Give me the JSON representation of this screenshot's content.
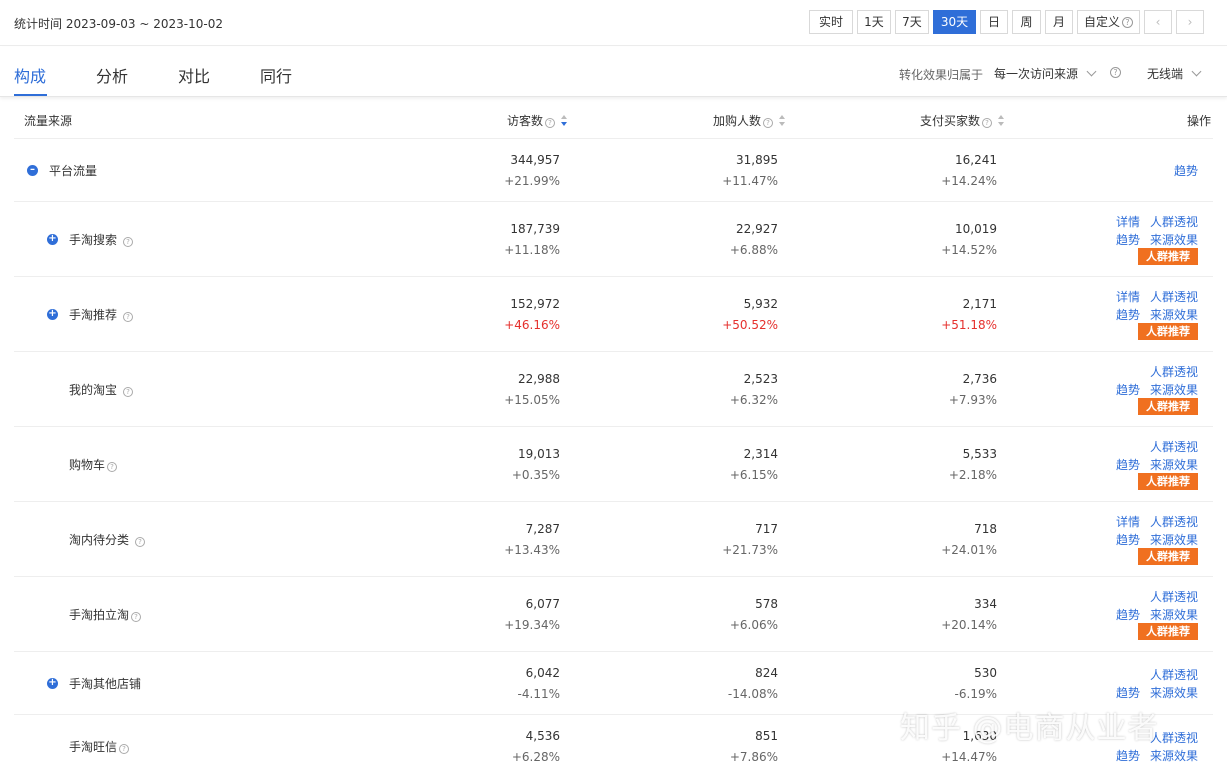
{
  "header": {
    "stat_time": "统计时间 2023-09-03 ~ 2023-10-02",
    "range_buttons": [
      "实时",
      "1天",
      "7天",
      "30天",
      "日",
      "周",
      "月",
      "自定义"
    ],
    "active_range": "30天",
    "prev_icon": "chevron-left-icon",
    "next_icon": "chevron-right-icon"
  },
  "tabs": [
    "构成",
    "分析",
    "对比",
    "同行"
  ],
  "active_tab": "构成",
  "attribution": {
    "label": "转化效果归属于",
    "value": "每一次访问来源",
    "device": "无线端"
  },
  "columns": {
    "source": "流量来源",
    "visitors": "访客数",
    "cart": "加购人数",
    "buyers": "支付买家数",
    "ops": "操作"
  },
  "rows": [
    {
      "name": "平台流量",
      "v": "344,957",
      "vp": "+21.99%",
      "c": "31,895",
      "cp": "+11.47%",
      "b": "16,241",
      "bp": "+14.24%"
    },
    {
      "name": "手淘搜索",
      "v": "187,739",
      "vp": "+11.18%",
      "c": "22,927",
      "cp": "+6.88%",
      "b": "10,019",
      "bp": "+14.52%"
    },
    {
      "name": "手淘推荐",
      "v": "152,972",
      "vp": "+46.16%",
      "c": "5,932",
      "cp": "+50.52%",
      "b": "2,171",
      "bp": "+51.18%"
    },
    {
      "name": "我的淘宝",
      "v": "22,988",
      "vp": "+15.05%",
      "c": "2,523",
      "cp": "+6.32%",
      "b": "2,736",
      "bp": "+7.93%"
    },
    {
      "name": "购物车",
      "v": "19,013",
      "vp": "+0.35%",
      "c": "2,314",
      "cp": "+6.15%",
      "b": "5,533",
      "bp": "+2.18%"
    },
    {
      "name": "淘内待分类",
      "v": "7,287",
      "vp": "+13.43%",
      "c": "717",
      "cp": "+21.73%",
      "b": "718",
      "bp": "+24.01%"
    },
    {
      "name": "手淘拍立淘",
      "v": "6,077",
      "vp": "+19.34%",
      "c": "578",
      "cp": "+6.06%",
      "b": "334",
      "bp": "+20.14%"
    },
    {
      "name": "手淘其他店铺",
      "v": "6,042",
      "vp": "-4.11%",
      "c": "824",
      "cp": "-14.08%",
      "b": "530",
      "bp": "-6.19%"
    },
    {
      "name": "手淘旺信",
      "v": "4,536",
      "vp": "+6.28%",
      "c": "851",
      "cp": "+7.86%",
      "b": "1,630",
      "bp": "+14.47%"
    }
  ],
  "ops": {
    "trend": "趋势",
    "detail": "详情",
    "crowd": "人群透视",
    "source_effect": "来源效果",
    "crowd_rec": "人群推荐"
  },
  "watermark": "知乎 @电商从业者",
  "colors": {
    "accent": "#2f6ed8",
    "up_red": "#e5302d",
    "tag_orange": "#f07020"
  }
}
